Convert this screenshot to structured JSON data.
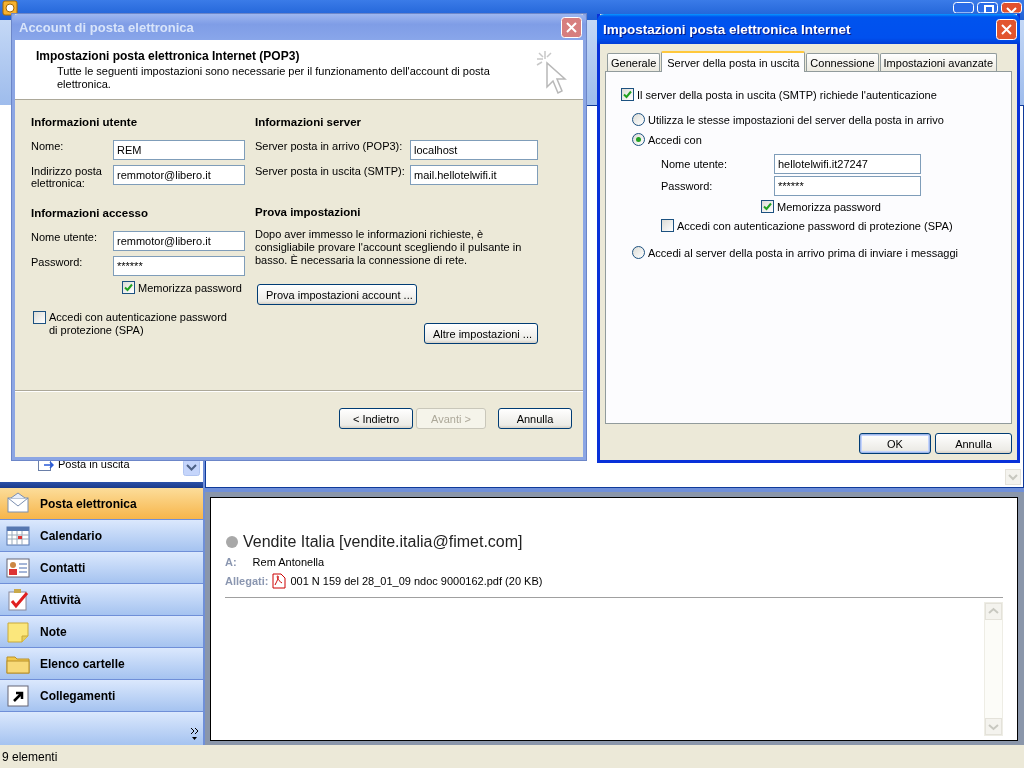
{
  "outlook": {
    "folder_items": [
      {
        "label": "Posta in uscita"
      }
    ],
    "nav_buttons": [
      {
        "label": "Posta elettronica",
        "selected": true
      },
      {
        "label": "Calendario",
        "selected": false
      },
      {
        "label": "Contatti",
        "selected": false
      },
      {
        "label": "Attività",
        "selected": false
      },
      {
        "label": "Note",
        "selected": false
      },
      {
        "label": "Elenco cartelle",
        "selected": false
      },
      {
        "label": "Collegamenti",
        "selected": false
      }
    ],
    "reading_pane": {
      "sender": "Vendite Italia [vendite.italia@fimet.com]",
      "to_label": "A:",
      "to": "Rem Antonella",
      "attachments_label": "Allegati:",
      "attachment": "001 N 159 del 28_01_09 ndoc 9000162.pdf (20 KB)"
    },
    "status_bar": "9 elementi"
  },
  "account_dialog": {
    "title": "Account di posta elettronica",
    "heading": "Impostazioni posta elettronica Internet (POP3)",
    "description": "Tutte le seguenti impostazioni sono necessarie per il funzionamento dell'account di posta elettronica.",
    "user_info": {
      "heading": "Informazioni utente",
      "fields": [
        {
          "label": "Nome:",
          "value": "REM"
        },
        {
          "label": "Indirizzo posta elettronica:",
          "value": "remmotor@libero.it"
        }
      ]
    },
    "access_info": {
      "heading": "Informazioni accesso",
      "fields": [
        {
          "label": "Nome utente:",
          "value": "remmotor@libero.it"
        },
        {
          "label": "Password:",
          "value": "******"
        }
      ],
      "remember": {
        "label": "Memorizza password",
        "checked": true
      },
      "spa": {
        "label": "Accedi con autenticazione password di protezione (SPA)",
        "checked": false
      }
    },
    "server_info": {
      "heading": "Informazioni server",
      "fields": [
        {
          "label": "Server posta in arrivo (POP3):",
          "value": "localhost"
        },
        {
          "label": "Server posta in uscita (SMTP):",
          "value": "mail.hellotelwifi.it"
        }
      ]
    },
    "test": {
      "heading": "Prova impostazioni",
      "text": "Dopo aver immesso le informazioni richieste, è consigliabile provare l'account scegliendo il pulsante in basso. È necessaria la connessione di rete.",
      "button": "Prova impostazioni account ..."
    },
    "more_button": "Altre impostazioni ...",
    "buttons": [
      {
        "label": "< Indietro",
        "disabled": false
      },
      {
        "label": "Avanti >",
        "disabled": true
      },
      {
        "label": "Annulla",
        "disabled": false
      }
    ]
  },
  "internet_dialog": {
    "title": "Impostazioni posta elettronica Internet",
    "tabs": [
      {
        "label": "Generale",
        "selected": false
      },
      {
        "label": "Server della posta in uscita",
        "selected": true
      },
      {
        "label": "Connessione",
        "selected": false
      },
      {
        "label": "Impostazioni avanzate",
        "selected": false
      }
    ],
    "auth_required": {
      "label": "Il server della posta in uscita (SMTP) richiede l'autenticazione",
      "checked": true
    },
    "login_options": [
      {
        "label": "Utilizza le stesse impostazioni del server della posta in arrivo",
        "selected": false
      },
      {
        "label": "Accedi con",
        "selected": true
      },
      {
        "label": "Accedi al server della posta in arrivo prima di inviare i messaggi",
        "selected": false
      }
    ],
    "fields": [
      {
        "label": "Nome utente:",
        "value": "hellotelwifi.it27247"
      },
      {
        "label": "Password:",
        "value": "******"
      }
    ],
    "remember": {
      "label": "Memorizza password",
      "checked": true
    },
    "spa": {
      "label": "Accedi con autenticazione password di protezione (SPA)",
      "checked": false
    },
    "buttons": [
      {
        "label": "OK",
        "default": true
      },
      {
        "label": "Annulla",
        "default": false
      }
    ]
  }
}
